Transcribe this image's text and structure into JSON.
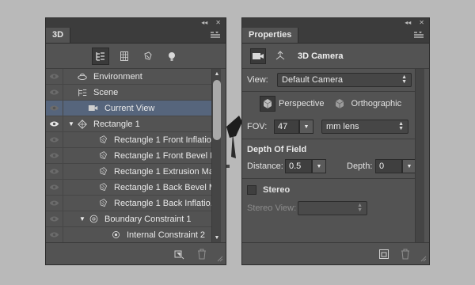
{
  "panel3d": {
    "tab_label": "3D",
    "toolbar": [
      {
        "name": "whole-scene-icon",
        "active": true
      },
      {
        "name": "meshes-icon",
        "active": false
      },
      {
        "name": "materials-icon",
        "active": false
      },
      {
        "name": "lights-icon",
        "active": false
      }
    ],
    "rows": [
      {
        "label": "Environment",
        "indent": 0,
        "icon": "environment-icon",
        "twirl": "",
        "eye": false,
        "selected": false
      },
      {
        "label": "Scene",
        "indent": 0,
        "icon": "scene-icon",
        "twirl": "",
        "eye": false,
        "selected": false
      },
      {
        "label": "Current View",
        "indent": 1,
        "icon": "camera-icon",
        "twirl": "",
        "eye": false,
        "selected": true
      },
      {
        "label": "Rectangle 1",
        "indent": 0,
        "icon": "mesh-icon",
        "twirl": "▼",
        "eye": true,
        "selected": false
      },
      {
        "label": "Rectangle 1 Front Inflatio...",
        "indent": 2,
        "icon": "material-icon",
        "twirl": "",
        "eye": false,
        "selected": false
      },
      {
        "label": "Rectangle 1 Front Bevel M...",
        "indent": 2,
        "icon": "material-icon",
        "twirl": "",
        "eye": false,
        "selected": false
      },
      {
        "label": "Rectangle 1 Extrusion Mat...",
        "indent": 2,
        "icon": "material-icon",
        "twirl": "",
        "eye": false,
        "selected": false
      },
      {
        "label": "Rectangle 1 Back Bevel M...",
        "indent": 2,
        "icon": "material-icon",
        "twirl": "",
        "eye": false,
        "selected": false
      },
      {
        "label": "Rectangle 1 Back Inflatio...",
        "indent": 2,
        "icon": "material-icon",
        "twirl": "",
        "eye": false,
        "selected": false
      },
      {
        "label": "Boundary Constraint 1",
        "indent": 1,
        "icon": "constraint-icon",
        "twirl": "▼",
        "eye": false,
        "selected": false
      },
      {
        "label": "Internal Constraint 2",
        "indent": 3,
        "icon": "internal-constraint-icon",
        "twirl": "",
        "eye": false,
        "selected": false
      }
    ]
  },
  "properties": {
    "tab_label": "Properties",
    "title": "3D Camera",
    "view_label": "View:",
    "view_value": "Default Camera",
    "perspective_label": "Perspective",
    "orthographic_label": "Orthographic",
    "fov_label": "FOV:",
    "fov_value": "47",
    "lens_value": "mm lens",
    "dof_title": "Depth Of Field",
    "distance_label": "Distance:",
    "distance_value": "0.5",
    "depth_label": "Depth:",
    "depth_value": "0",
    "stereo_label": "Stereo",
    "stereo_view_label": "Stereo View:",
    "stereo_view_value": ""
  },
  "colors": {
    "panel_bg": "#535353",
    "selected_row": "#56657c",
    "canvas_bg": "#b9b9b9"
  }
}
